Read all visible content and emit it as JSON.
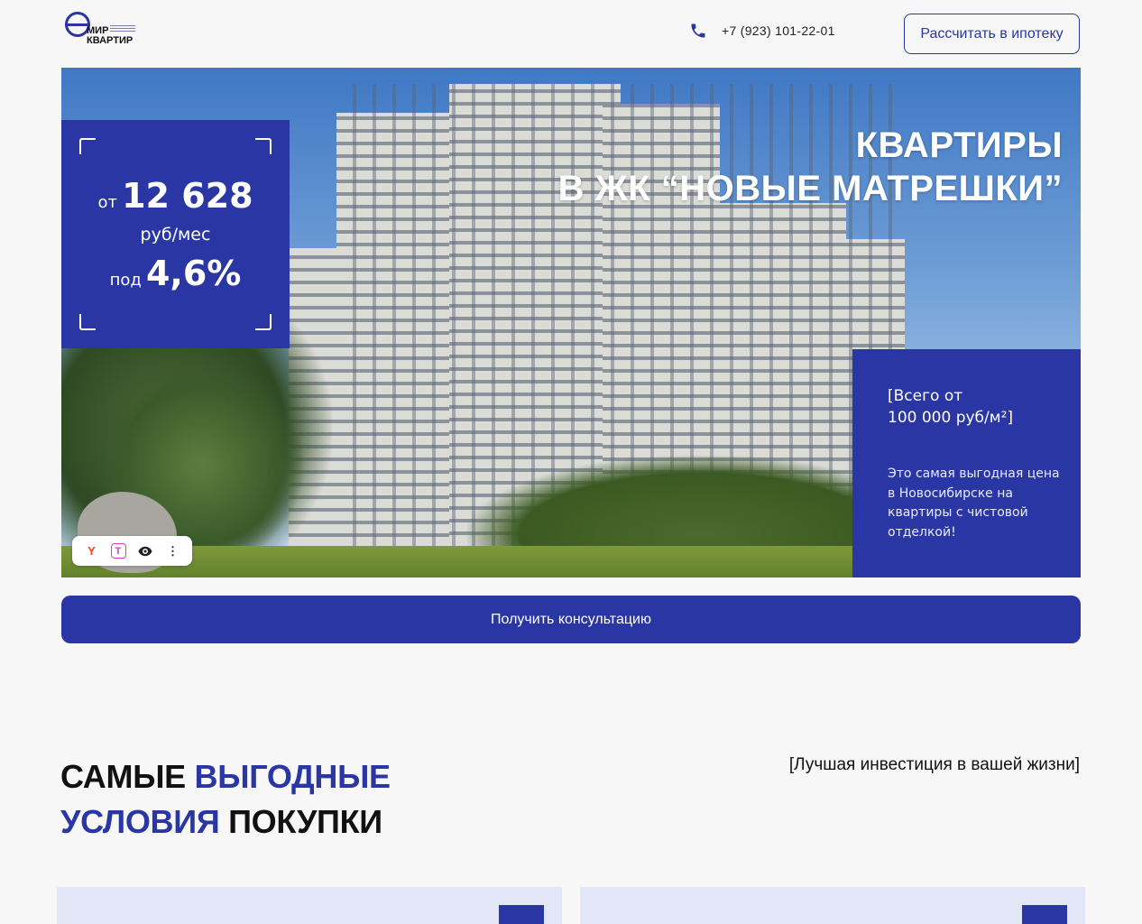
{
  "header": {
    "logo_line1": "МИР",
    "logo_line2": "КВАРТИР",
    "phone": "+7 (923) 101-22-01",
    "mortgage_button": "Рассчитать в ипотеку"
  },
  "hero": {
    "title_line1": "КВАРТИРЫ",
    "title_line2": "В ЖК “НОВЫЕ МАТРЕШКИ”",
    "price_card": {
      "from_label": "от",
      "amount": "12 628",
      "unit": "руб/мес",
      "rate_label": "под",
      "rate": "4,6%"
    },
    "offer_card": {
      "head_line1": "[Всего от",
      "head_line2": "100 000 руб/м²]",
      "description": "Это самая выгодная цена в Новосибирске на квартиры с чистовой отделкой!"
    }
  },
  "yandex_bar": {
    "y_icon": "Y",
    "t_icon": "T",
    "eye_icon": "👁",
    "more_icon": "⋮"
  },
  "consult_button": "Получить консультацию",
  "benefits": {
    "title_part1": "САМЫЕ ",
    "title_part2": "ВЫГОДНЫЕ",
    "title_part3": "УСЛОВИЯ",
    "title_part4": " ПОКУПКИ",
    "tagline": "[Лучшая инвестиция в вашей жизни]"
  },
  "colors": {
    "accent": "#2a36a3",
    "card_bg": "#e2e6f6",
    "page_bg": "#f7f7f8"
  },
  "icons": {
    "phone": "phone-icon",
    "card1": "hand-coin-icon",
    "card2": "house-icon"
  }
}
